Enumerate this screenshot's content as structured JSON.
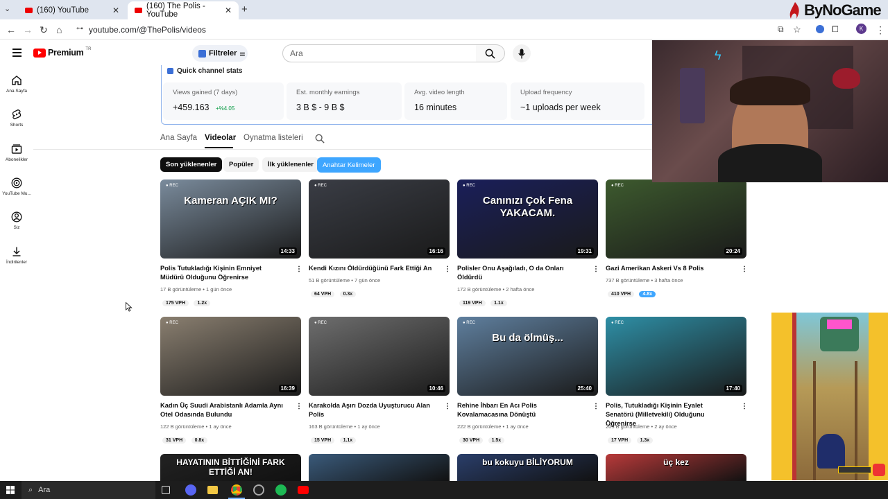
{
  "browser": {
    "tabs": [
      {
        "title": "(160) YouTube"
      },
      {
        "title": "(160) The Polis - YouTube"
      }
    ],
    "url": "youtube.com/@ThePolis/videos",
    "profile_initial": "K"
  },
  "watermark": "ByNoGame",
  "header": {
    "logo": "Premium",
    "logo_region": "TR",
    "filter_label": "Filtreler",
    "search_placeholder": "Ara"
  },
  "sidebar": {
    "items": [
      {
        "label": "Ana Sayfa"
      },
      {
        "label": "Shorts"
      },
      {
        "label": "Abonelikler"
      },
      {
        "label": "YouTube Mu..."
      },
      {
        "label": "Siz"
      },
      {
        "label": "İndirilenler"
      }
    ]
  },
  "stats": {
    "title": "Quick channel stats",
    "cards": [
      {
        "label": "Views gained (7 days)",
        "value": "+459.163",
        "delta": "+%4.05"
      },
      {
        "label": "Est. monthly earnings",
        "value": "3 B $ - 9 B $"
      },
      {
        "label": "Avg. video length",
        "value": "16 minutes"
      },
      {
        "label": "Upload frequency",
        "value": "~1 uploads per week"
      }
    ]
  },
  "channel_tabs": [
    "Ana Sayfa",
    "Videolar",
    "Oynatma listeleri"
  ],
  "chips": [
    "Son yüklenenler",
    "Popüler",
    "İlk yüklenenler",
    "Anahtar Kelimeler"
  ],
  "videos": [
    {
      "title": "Polis Tutukladığı Kişinin Emniyet Müdürü Olduğunu Öğrenirse",
      "views": "17 B görüntüleme",
      "age": "1 gün önce",
      "vph": "175 VPH",
      "mult": "1.2x",
      "duration": "14:33",
      "thumb_text": "Kameran AÇIK MI?",
      "bg": "#7a8b9c",
      "hl": false
    },
    {
      "title": "Kendi Kızını Öldürdüğünü Fark Ettiği An",
      "views": "51 B görüntüleme",
      "age": "7 gün önce",
      "vph": "64 VPH",
      "mult": "0.3x",
      "duration": "16:16",
      "thumb_text": "",
      "bg": "#3a3d45",
      "hl": false
    },
    {
      "title": "Polisler Onu Aşağıladı, O da Onları Öldürdü",
      "views": "172 B görüntüleme",
      "age": "2 hafta önce",
      "vph": "119 VPH",
      "mult": "1.1x",
      "duration": "19:31",
      "thumb_text": "Canınızı Çok Fena YAKACAM.",
      "bg": "#1a1f5a",
      "hl": false
    },
    {
      "title": "Gazi Amerikan Askeri Vs 8 Polis",
      "views": "737 B görüntüleme",
      "age": "3 hafta önce",
      "vph": "410 VPH",
      "mult": "4.8x",
      "duration": "20:24",
      "thumb_text": "",
      "bg": "#3d5a2e",
      "hl": true
    },
    {
      "title": "Kadın Üç Suudi Arabistanlı Adamla Aynı Otel Odasında Bulundu",
      "views": "122 B görüntüleme",
      "age": "1 ay önce",
      "vph": "31 VPH",
      "mult": "0.8x",
      "duration": "16:39",
      "thumb_text": "",
      "bg": "#8a7f70",
      "hl": false
    },
    {
      "title": "Karakolda Aşırı Dozda Uyuşturucu Alan Polis",
      "views": "163 B görüntüleme",
      "age": "1 ay önce",
      "vph": "15 VPH",
      "mult": "1.1x",
      "duration": "10:46",
      "thumb_text": "",
      "bg": "#6e6e6e",
      "hl": false
    },
    {
      "title": "Rehine İhbarı En Acı Polis Kovalamacasına Dönüştü",
      "views": "222 B görüntüleme",
      "age": "1 ay önce",
      "vph": "30 VPH",
      "mult": "1.5x",
      "duration": "25:40",
      "thumb_text": "Bu da ölmüş...",
      "bg": "#5f7f9e",
      "hl": false
    },
    {
      "title": "Polis, Tutukladığı Kişinin Eyalet Senatörü (Milletvekili) Olduğunu Öğrenirse",
      "views": "205 B görüntüleme",
      "age": "2 ay önce",
      "vph": "17 VPH",
      "mult": "1.3x",
      "duration": "17:40",
      "thumb_text": "",
      "bg": "#2e8fa6",
      "hl": false
    }
  ],
  "partial_thumbs": [
    {
      "text": "HAYATININ BİTTİĞİNİ FARK ETTİĞİ AN!",
      "bg": "#222"
    },
    {
      "text": "",
      "bg": "#3a5a7a"
    },
    {
      "text": "bu kokuyu BİLİYORUM",
      "bg": "#2a3e6a"
    },
    {
      "text": "üç kez",
      "bg": "#b83a3a"
    }
  ],
  "taskbar": {
    "search_placeholder": "Ara"
  },
  "colors": {
    "accent": "#065fd4",
    "chip_active": "#0f0f0f",
    "chip_keyword": "#3ea6ff",
    "delta_green": "#0a9b45"
  }
}
